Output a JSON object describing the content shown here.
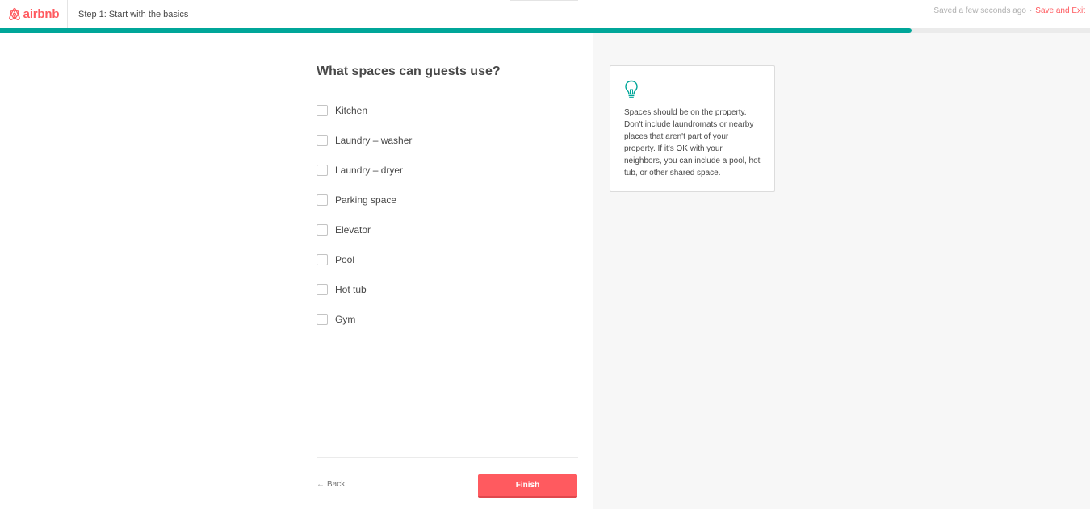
{
  "brand": {
    "name": "airbnb",
    "logo_icon": "airbnb-belo-icon",
    "color": "#ff5a5f"
  },
  "header": {
    "step_title": "Step 1: Start with the basics",
    "saved_status": "Saved a few seconds ago",
    "separator": "·",
    "save_exit_label": "Save and Exit"
  },
  "progress": {
    "fraction": 0.836,
    "color": "#00a699"
  },
  "main": {
    "question": "What spaces can guests use?",
    "options": [
      {
        "label": "Kitchen",
        "checked": false
      },
      {
        "label": "Laundry – washer",
        "checked": false
      },
      {
        "label": "Laundry – dryer",
        "checked": false
      },
      {
        "label": "Parking space",
        "checked": false
      },
      {
        "label": "Elevator",
        "checked": false
      },
      {
        "label": "Pool",
        "checked": false
      },
      {
        "label": "Hot tub",
        "checked": false
      },
      {
        "label": "Gym",
        "checked": false
      }
    ]
  },
  "footer": {
    "back_icon": "arrow-left-icon",
    "back_label": "Back",
    "finish_label": "Finish"
  },
  "tip": {
    "icon": "lightbulb-icon",
    "icon_color": "#00a699",
    "text": "Spaces should be on the property. Don't include laundromats or nearby places that aren't part of your property. If it's OK with your neighbors, you can include a pool, hot tub, or other shared space."
  }
}
